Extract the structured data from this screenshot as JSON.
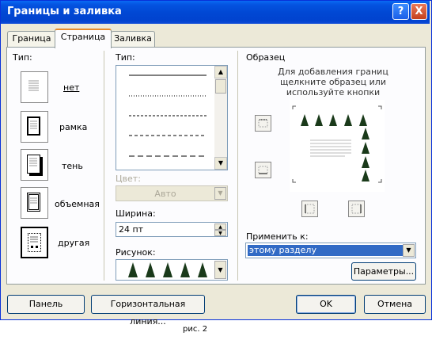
{
  "window": {
    "title": "Границы и заливка",
    "help_label": "?",
    "close_label": "X"
  },
  "tabs": [
    {
      "label": "Граница"
    },
    {
      "label": "Страница"
    },
    {
      "label": "Заливка"
    }
  ],
  "type_section": {
    "label": "Тип:",
    "options": [
      {
        "label": "нет"
      },
      {
        "label": "рамка"
      },
      {
        "label": "тень"
      },
      {
        "label": "объемная"
      },
      {
        "label": "другая"
      }
    ]
  },
  "line_style": {
    "label": "Тип:"
  },
  "color": {
    "label": "Цвет:",
    "value": "Авто"
  },
  "width": {
    "label": "Ширина:",
    "value": "24 пт"
  },
  "art": {
    "label": "Рисунок:"
  },
  "preview": {
    "title": "Образец",
    "hint": "Для добавления границ щелкните образец или используйте кнопки"
  },
  "apply_to": {
    "label": "Применить к:",
    "value": "этому разделу"
  },
  "buttons": {
    "options": "Параметры...",
    "panel": "Панель",
    "horizontal_line": "Горизонтальная линия...",
    "ok": "OK",
    "cancel": "Отмена"
  },
  "caption": "рис. 2"
}
